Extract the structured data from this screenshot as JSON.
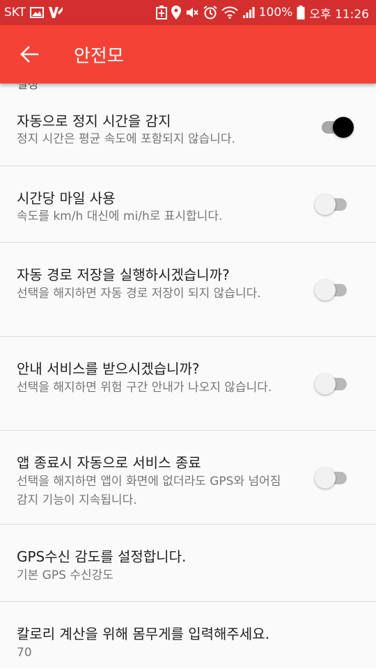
{
  "status_bar": {
    "carrier": "SKT",
    "battery_percent": "100%",
    "time": "오후 11:26",
    "icons": [
      "gallery-icon",
      "v-app-icon",
      "battery-saver-icon",
      "location-icon",
      "mute-icon",
      "alarm-icon",
      "wifi-icon",
      "signal-icon",
      "battery-icon"
    ]
  },
  "app_bar": {
    "title": "안전모",
    "back_icon": "arrow-left-icon"
  },
  "content": {
    "cut_label": "설정",
    "rows": [
      {
        "title": "자동으로 정지 시간을 감지",
        "summary": "정지 시간은 평균 속도에 포함되지 않습니다.",
        "switch_on": true
      },
      {
        "title": "시간당 마일 사용",
        "summary": "속도를 km/h 대신에 mi/h로 표시합니다.",
        "switch_on": false
      },
      {
        "title": "자동 경로 저장을 실행하시겠습니까?",
        "summary": "선택을 해지하면 자동 경로 저장이 되지 않습니다.",
        "switch_on": false
      },
      {
        "title": "안내 서비스를 받으시겠습니까?",
        "summary": "선택을 해지하면 위험 구간 안내가 나오지 않습니다.",
        "switch_on": false
      },
      {
        "title": "앱 종료시 자동으로 서비스 종료",
        "summary": "선택을 해지하면 앱이 화면에 없더라도 GPS와 넘어짐 감지 기능이 지속됩니다.",
        "switch_on": false
      },
      {
        "title": "GPS수신 감도를 설정합니다.",
        "summary": "기본 GPS 수신강도"
      },
      {
        "title": "칼로리 계산을 위해 몸무게를 입력해주세요.",
        "summary": "70"
      }
    ]
  },
  "colors": {
    "status_bar": "#d32f2f",
    "app_bar": "#f44336",
    "background": "#fafafa",
    "title_text": "#212121",
    "summary_text": "#757575"
  }
}
